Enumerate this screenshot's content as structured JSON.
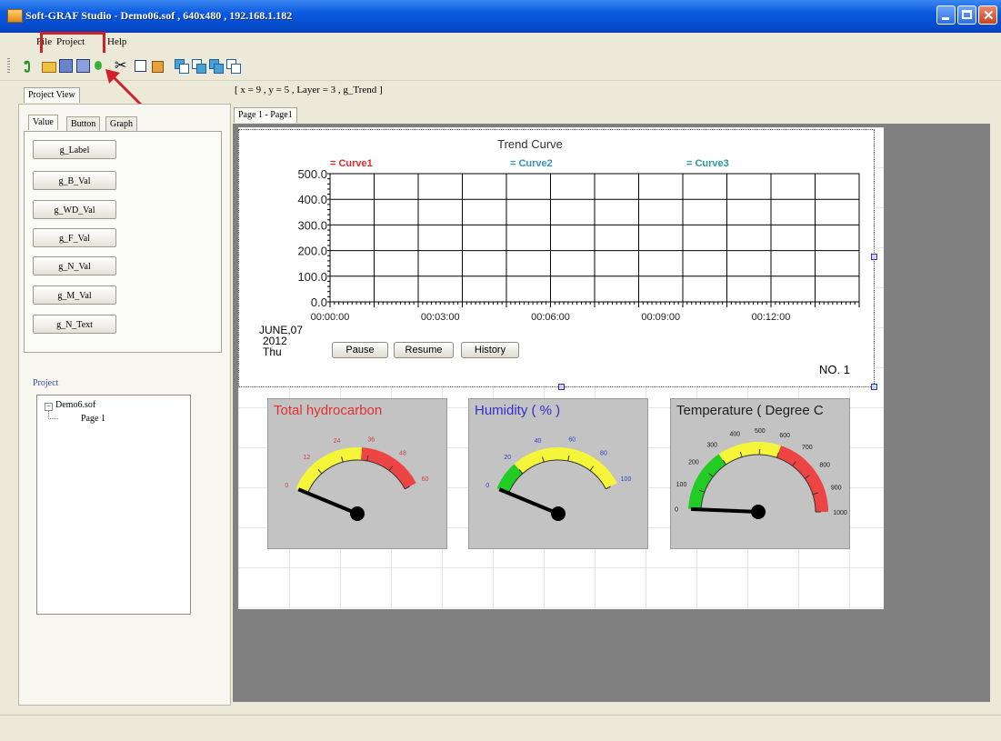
{
  "window": {
    "title": "Soft-GRAF Studio - Demo06.sof , 640x480 , 192.168.1.182"
  },
  "menu": {
    "file": "File",
    "project": "Project",
    "help": "Help"
  },
  "status": {
    "coords": "[ x = 9 , y = 5 , Layer = 3 , g_Trend ]"
  },
  "left_panel": {
    "tab_label": "Project View",
    "subtabs": [
      "Value",
      "Button",
      "Graph"
    ],
    "value_buttons": [
      "g_Label",
      "g_B_Val",
      "g_WD_Val",
      "g_F_Val",
      "g_N_Val",
      "g_M_Val",
      "g_N_Text"
    ],
    "project_label": "Project",
    "tree": {
      "root": "Demo6.sof",
      "child": "Page 1"
    }
  },
  "page_tab": "Page 1 - Page1",
  "chart_data": {
    "type": "line",
    "title": "Trend Curve",
    "series": [
      {
        "name": "Curve1",
        "color": "#e02828",
        "values": []
      },
      {
        "name": "Curve2",
        "color": "#3a8fc8",
        "values": []
      },
      {
        "name": "Curve3",
        "color": "#2a9a9a",
        "values": []
      }
    ],
    "yticks": [
      "500.0",
      "400.0",
      "300.0",
      "200.0",
      "100.0",
      "0.0"
    ],
    "ylim": [
      0,
      500
    ],
    "xticks": [
      "00:00:00",
      "00:03:00",
      "00:06:00",
      "00:09:00",
      "00:12:00"
    ],
    "grid": true
  },
  "trend": {
    "date_line1": "JUNE,07",
    "date_line2": "2012",
    "date_line3": "Thu",
    "buttons": {
      "pause": "Pause",
      "resume": "Resume",
      "history": "History"
    },
    "number": "NO. 1"
  },
  "gauges": [
    {
      "title": "Total hydrocarbon",
      "title_color": "#e03030",
      "ticks": [
        "0",
        "12",
        "24",
        "36",
        "48",
        "60"
      ],
      "tick_color": "#d04040",
      "needle_value": 0
    },
    {
      "title": "Humidity ( % )",
      "title_color": "#3030c8",
      "ticks": [
        "0",
        "20",
        "40",
        "60",
        "80",
        "100"
      ],
      "tick_color": "#3040c0",
      "needle_value": 0
    },
    {
      "title": "Temperature ( Degree C",
      "title_color": "#202020",
      "ticks": [
        "0",
        "100",
        "200",
        "300",
        "400",
        "500",
        "600",
        "700",
        "800",
        "900",
        "1000"
      ],
      "tick_color": "#202020",
      "needle_value": 0
    }
  ]
}
